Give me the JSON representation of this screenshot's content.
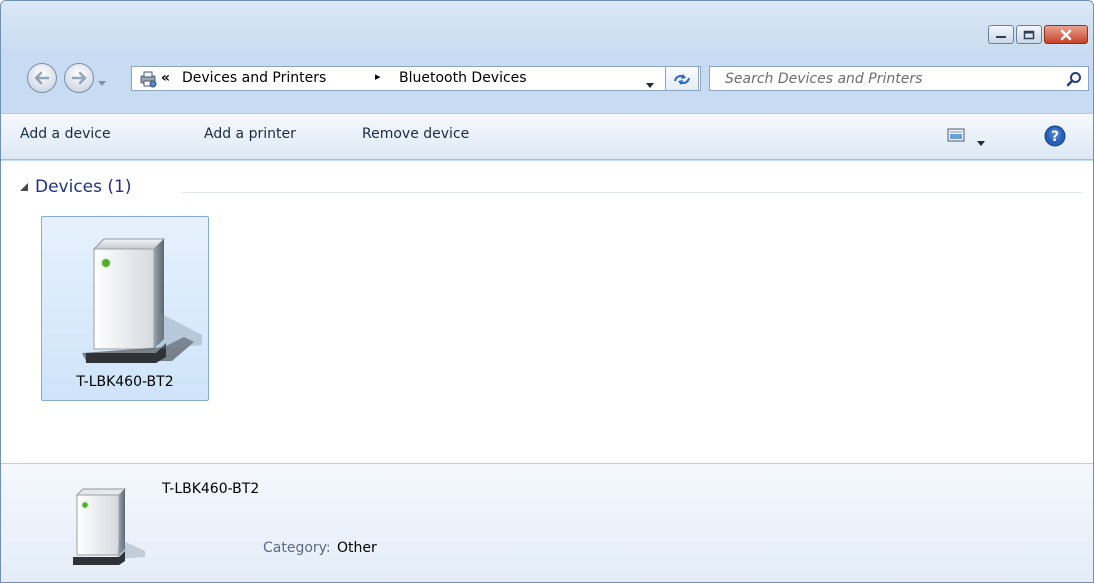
{
  "address": {
    "overflow": "«",
    "crumbs": [
      "Devices and Printers",
      "Bluetooth Devices"
    ],
    "separator": "▸"
  },
  "search": {
    "placeholder": "Search Devices and Printers"
  },
  "toolbar": {
    "add_device": "Add a device",
    "add_printer": "Add a printer",
    "remove_device": "Remove device"
  },
  "group": {
    "title": "Devices (1)"
  },
  "devices": [
    {
      "name": "T-LBK460-BT2",
      "icon": "bluetooth-device-icon"
    }
  ],
  "details": {
    "name": "T-LBK460-BT2",
    "category_label": "Category:",
    "category_value": "Other"
  },
  "colors": {
    "accent": "#1e3287",
    "selection": "#cfe4fa",
    "selection_border": "#84acdd",
    "close_button": "#c8432a"
  }
}
